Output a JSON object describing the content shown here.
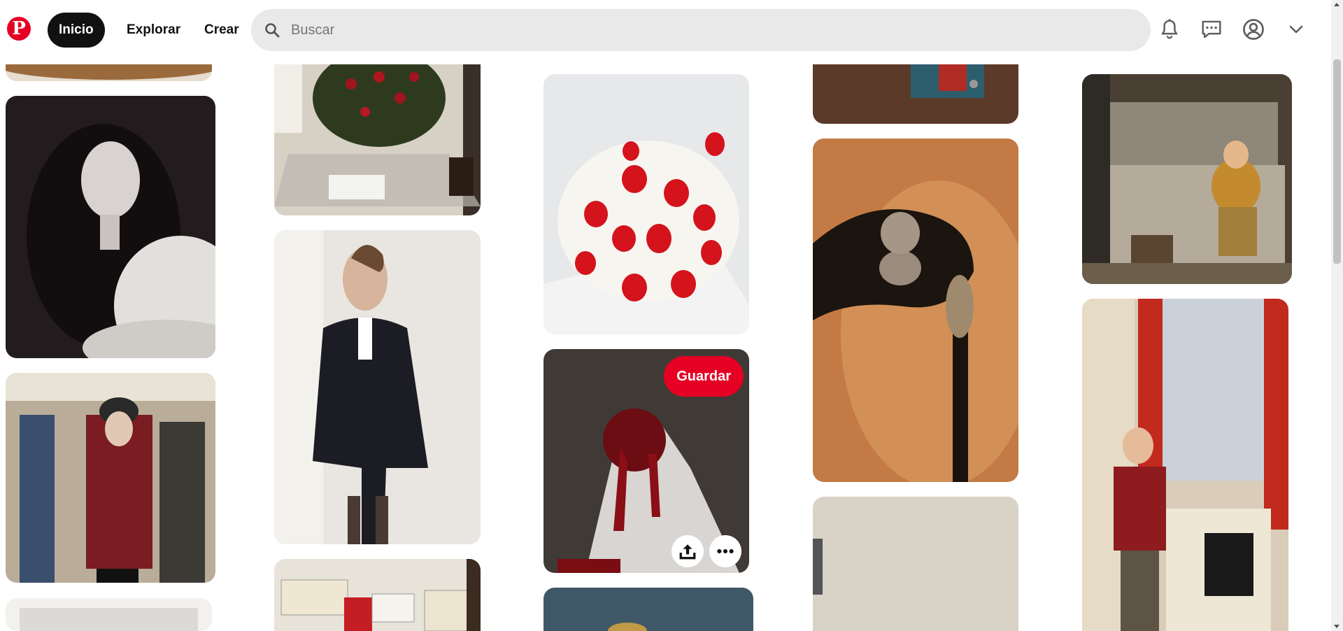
{
  "header": {
    "logo": "P",
    "nav": {
      "home": "Inicio",
      "explore": "Explorar",
      "create": "Crear"
    },
    "search": {
      "placeholder": "Buscar",
      "value": ""
    },
    "icons": [
      "bell-icon",
      "message-icon",
      "profile-icon",
      "chevron-down-icon"
    ]
  },
  "pins": {
    "save_label": "Guardar",
    "items": [
      {
        "name": "pin-cat-partial"
      },
      {
        "name": "pin-woman-bw-portrait"
      },
      {
        "name": "pin-school-hallway"
      },
      {
        "name": "pin-frame-partial"
      },
      {
        "name": "pin-roses-glass-table"
      },
      {
        "name": "pin-pinstripe-suit-model"
      },
      {
        "name": "pin-arabic-calligraphy-wall"
      },
      {
        "name": "pin-strawberry-cream-cake"
      },
      {
        "name": "pin-bloody-hand"
      },
      {
        "name": "pin-blue-partial"
      },
      {
        "name": "pin-wallet-partial"
      },
      {
        "name": "pin-skull-cane"
      },
      {
        "name": "pin-beige-texture"
      },
      {
        "name": "pin-limousine-kid"
      },
      {
        "name": "pin-kid-window"
      }
    ]
  },
  "colors": {
    "brand": "#e60023",
    "search_bg": "#e9e9e9",
    "active_nav": "#111111"
  }
}
